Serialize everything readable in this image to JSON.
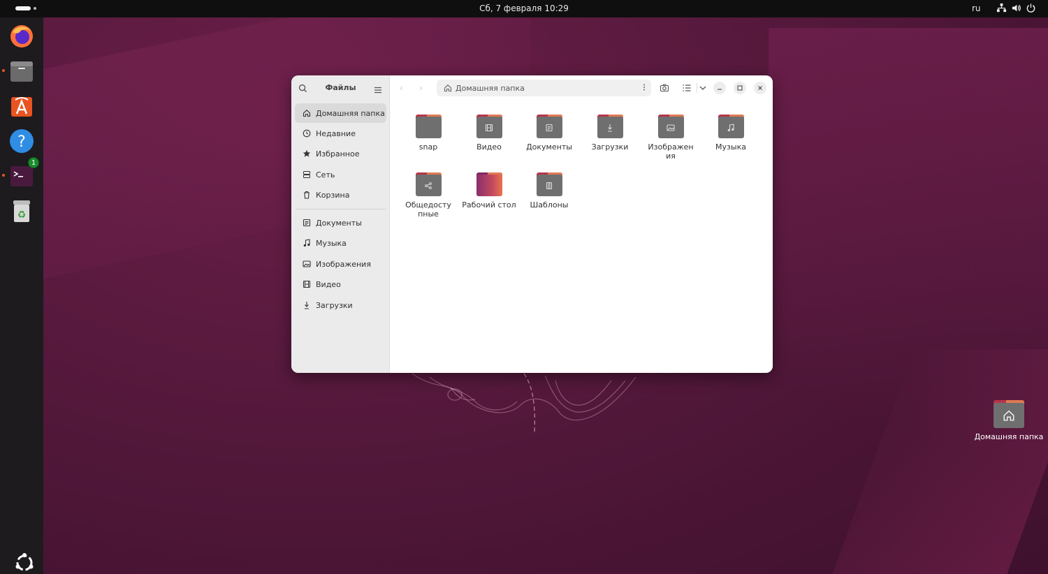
{
  "topbar": {
    "clock": "Сб, 7 февраля  10:29",
    "language": "ru",
    "tray_icons": [
      "network-icon",
      "volume-icon",
      "power-icon"
    ]
  },
  "dock": {
    "items": [
      {
        "name": "firefox",
        "icon": "firefox-icon",
        "running": false
      },
      {
        "name": "files",
        "icon": "files-icon",
        "running": true
      },
      {
        "name": "app-center",
        "icon": "app-center-icon",
        "running": false
      },
      {
        "name": "help",
        "icon": "help-icon",
        "running": false
      },
      {
        "name": "terminal",
        "icon": "terminal-icon",
        "running": true,
        "badge": "1"
      },
      {
        "name": "trash",
        "icon": "trash-icon",
        "running": false
      }
    ],
    "show_apps": "ubuntu-logo-icon"
  },
  "window": {
    "sidebar": {
      "title": "Файлы",
      "places": [
        {
          "label": "Домашняя папка",
          "icon": "home-icon",
          "active": true
        },
        {
          "label": "Недавние",
          "icon": "clock-icon",
          "active": false
        },
        {
          "label": "Избранное",
          "icon": "star-icon",
          "active": false
        },
        {
          "label": "Сеть",
          "icon": "network-icon",
          "active": false
        },
        {
          "label": "Корзина",
          "icon": "trash-icon",
          "active": false
        }
      ],
      "bookmarks": [
        {
          "label": "Документы",
          "icon": "document-icon"
        },
        {
          "label": "Музыка",
          "icon": "music-icon"
        },
        {
          "label": "Изображения",
          "icon": "image-icon"
        },
        {
          "label": "Видео",
          "icon": "video-icon"
        },
        {
          "label": "Загрузки",
          "icon": "download-icon"
        }
      ]
    },
    "path": "Домашняя папка",
    "files": [
      {
        "label": "snap",
        "emblem": ""
      },
      {
        "label": "Видео",
        "emblem": "video"
      },
      {
        "label": "Документы",
        "emblem": "document"
      },
      {
        "label": "Загрузки",
        "emblem": "download"
      },
      {
        "label": "Изображен ия",
        "emblem": "image"
      },
      {
        "label": "Музыка",
        "emblem": "music"
      },
      {
        "label": "Общедосту пные",
        "emblem": "share"
      },
      {
        "label": "Рабочий стол",
        "emblem": "desktop"
      },
      {
        "label": "Шаблоны",
        "emblem": "template"
      }
    ]
  },
  "desktop": {
    "icons": [
      {
        "label": "Домашняя папка",
        "icon": "home-folder-icon"
      }
    ]
  },
  "colors": {
    "accent": "#e95420",
    "folder_tab": "#b5364a",
    "folder_body": "#6f6f6f"
  }
}
